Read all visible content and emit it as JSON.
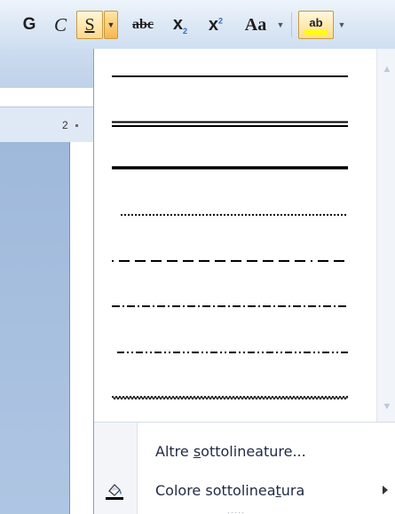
{
  "toolbar": {
    "bold_label": "G",
    "italic_label": "C",
    "underline_label": "S",
    "strikethrough_label": "abc",
    "subscript_label": "x",
    "subscript_mark": "2",
    "superscript_label": "x",
    "superscript_mark": "2",
    "change_case_label": "Aa",
    "highlight_label": "ab",
    "highlight_color": "#ffff00"
  },
  "ruler": {
    "number": "2"
  },
  "underline_styles": [
    {
      "name": "single"
    },
    {
      "name": "double"
    },
    {
      "name": "thick"
    },
    {
      "name": "dotted"
    },
    {
      "name": "dashed"
    },
    {
      "name": "dot-dash"
    },
    {
      "name": "dot-dot-dash"
    },
    {
      "name": "wave"
    }
  ],
  "menu": {
    "more_underlines_pre": "Altre ",
    "more_underlines_key": "s",
    "more_underlines_post": "ottolineature...",
    "underline_color_pre": "Colore sottolinea",
    "underline_color_key": "t",
    "underline_color_post": "ura"
  },
  "colors": {
    "accent_hover": "#ffd98b",
    "menu_border": "#8ba0bc",
    "ribbon_bg": "#dbe7f5"
  }
}
